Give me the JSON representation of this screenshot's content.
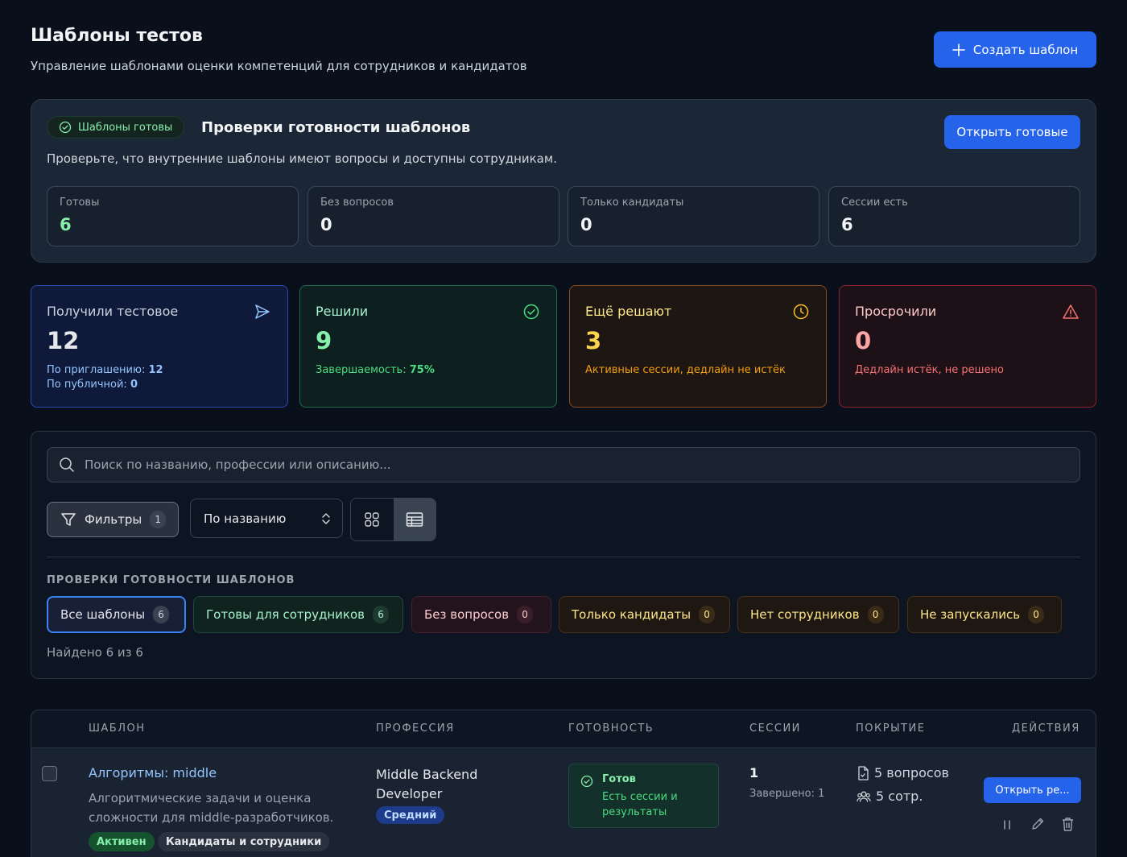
{
  "header": {
    "title": "Шаблоны тестов",
    "subtitle": "Управление шаблонами оценки компетенций для сотрудников и кандидатов",
    "create_label": "Создать шаблон"
  },
  "readiness": {
    "badge": "Шаблоны готовы",
    "title": "Проверки готовности шаблонов",
    "open_label": "Открыть готовые",
    "description": "Проверьте, что внутренние шаблоны имеют вопросы и доступны сотрудникам.",
    "cards": [
      {
        "label": "Готовы",
        "value": "6"
      },
      {
        "label": "Без вопросов",
        "value": "0"
      },
      {
        "label": "Только кандидаты",
        "value": "0"
      },
      {
        "label": "Сессии есть",
        "value": "6"
      }
    ]
  },
  "stats": {
    "received": {
      "label": "Получили тестовое",
      "value": "12",
      "line1_prefix": "По приглашению: ",
      "line1_value": "12",
      "line2_prefix": "По публичной: ",
      "line2_value": "0"
    },
    "solved": {
      "label": "Решили",
      "value": "9",
      "sub_prefix": "Завершаемость: ",
      "sub_value": "75%"
    },
    "in_progress": {
      "label": "Ещё решают",
      "value": "3",
      "sub": "Активные сессии, дедлайн не истёк"
    },
    "overdue": {
      "label": "Просрочили",
      "value": "0",
      "sub": "Дедлайн истёк, не решено"
    }
  },
  "filters": {
    "search_placeholder": "Поиск по названию, профессии или описанию...",
    "filters_label": "Фильтры",
    "filters_count": "1",
    "sort_value": "По названию",
    "section_label": "ПРОВЕРКИ ГОТОВНОСТИ ШАБЛОНОВ",
    "chips": [
      {
        "label": "Все шаблоны",
        "count": "6"
      },
      {
        "label": "Готовы для сотрудников",
        "count": "6"
      },
      {
        "label": "Без вопросов",
        "count": "0"
      },
      {
        "label": "Только кандидаты",
        "count": "0"
      },
      {
        "label": "Нет сотрудников",
        "count": "0"
      },
      {
        "label": "Не запускались",
        "count": "0"
      }
    ],
    "found_text": "Найдено 6 из 6"
  },
  "table": {
    "columns": [
      "ШАБЛОН",
      "ПРОФЕССИЯ",
      "ГОТОВНОСТЬ",
      "СЕССИИ",
      "ПОКРЫТИЕ",
      "ДЕЙСТВИЯ"
    ],
    "rows": [
      {
        "title": "Алгоритмы: middle",
        "description": "Алгоритмические задачи и оценка сложности для middle-разработчиков.",
        "tags": [
          "Активен",
          "Кандидаты и сотрудники"
        ],
        "profession": "Middle Backend Developer",
        "level": "Средний",
        "status_title": "Готов",
        "status_desc": "Есть сессии и результаты",
        "sessions": "1",
        "completed": "Завершено: 1",
        "questions": "5 вопросов",
        "employees": "5 сотр.",
        "open_label": "Открыть ре..."
      }
    ]
  }
}
